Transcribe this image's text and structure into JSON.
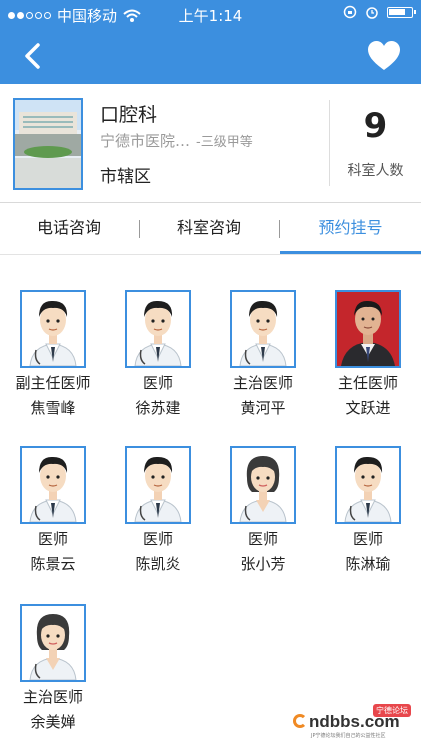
{
  "status": {
    "carrier": "中国移动",
    "time": "上午1:14"
  },
  "header": {
    "dept_name": "口腔科",
    "hospital": "宁德市医院…",
    "level": "-三级甲等",
    "district": "市辖区",
    "staff_count": "9",
    "staff_label": "科室人数"
  },
  "tabs": [
    {
      "label": "电话咨询"
    },
    {
      "label": "科室咨询"
    },
    {
      "label": "预约挂号",
      "active": true
    }
  ],
  "doctors": [
    {
      "title": "副主任医师",
      "name": "焦雪峰",
      "gender": "male"
    },
    {
      "title": "医师",
      "name": "徐苏建",
      "gender": "male"
    },
    {
      "title": "主治医师",
      "name": "黄河平",
      "gender": "male"
    },
    {
      "title": "主任医师",
      "name": "文跃进",
      "gender": "photo"
    },
    {
      "title": "医师",
      "name": "陈景云",
      "gender": "male"
    },
    {
      "title": "医师",
      "name": "陈凯炎",
      "gender": "male"
    },
    {
      "title": "医师",
      "name": "张小芳",
      "gender": "female"
    },
    {
      "title": "医师",
      "name": "陈淋瑜",
      "gender": "male"
    },
    {
      "title": "主治医师",
      "name": "余美婵",
      "gender": "female"
    }
  ],
  "watermark": {
    "text": "ndbbs.com",
    "badge": "宁德论坛",
    "sub": "JP宁德论坛我们自己的公益性社区"
  },
  "colors": {
    "primary": "#3c8fdf",
    "gray_text": "#9a9a9a"
  }
}
